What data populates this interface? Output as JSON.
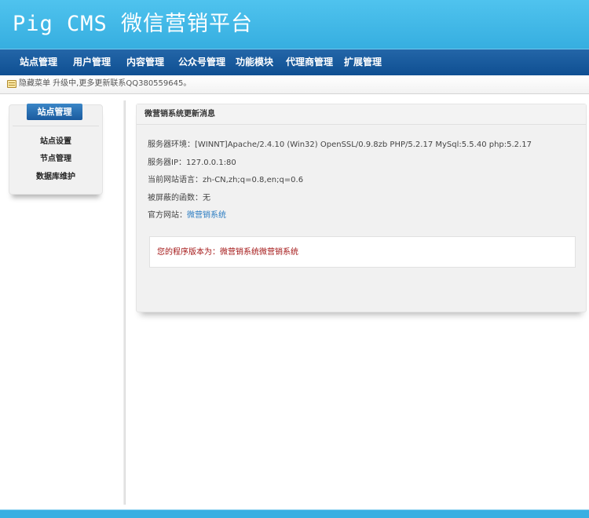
{
  "header": {
    "logo": "Pig CMS 微信营销平台"
  },
  "nav": {
    "items": [
      {
        "label": "站点管理"
      },
      {
        "label": "用户管理"
      },
      {
        "label": "内容管理"
      },
      {
        "label": "公众号管理"
      },
      {
        "label": "功能模块"
      },
      {
        "label": "代理商管理"
      },
      {
        "label": "扩展管理"
      }
    ]
  },
  "notice": {
    "icon": "notice-icon",
    "text": "隐藏菜单 升级中,更多更新联系QQ380559645。"
  },
  "sidebar": {
    "title": "站点管理",
    "items": [
      {
        "label": "站点设置"
      },
      {
        "label": "节点管理"
      },
      {
        "label": "数据库维护"
      }
    ]
  },
  "panel": {
    "title": "微营销系统更新消息",
    "server_env": "服务器环境：[WINNT]Apache/2.4.10 (Win32) OpenSSL/0.9.8zb PHP/5.2.17 MySql:5.5.40 php:5.2.17",
    "server_ip": "服务器IP：127.0.0.1:80",
    "site_language": "当前网站语言：zh-CN,zh;q=0.8,en;q=0.6",
    "disabled_functions": "被屏蔽的函数：无",
    "official_site_label": "官方网站：",
    "official_site_link": "微营销系统",
    "version_text": "您的程序版本为：微营销系统微营销系统"
  },
  "colors": {
    "header_bg": "#4fc3ee",
    "nav_bg": "#1a5a9e",
    "link": "#2a7cc2",
    "version_text": "#a31515"
  }
}
